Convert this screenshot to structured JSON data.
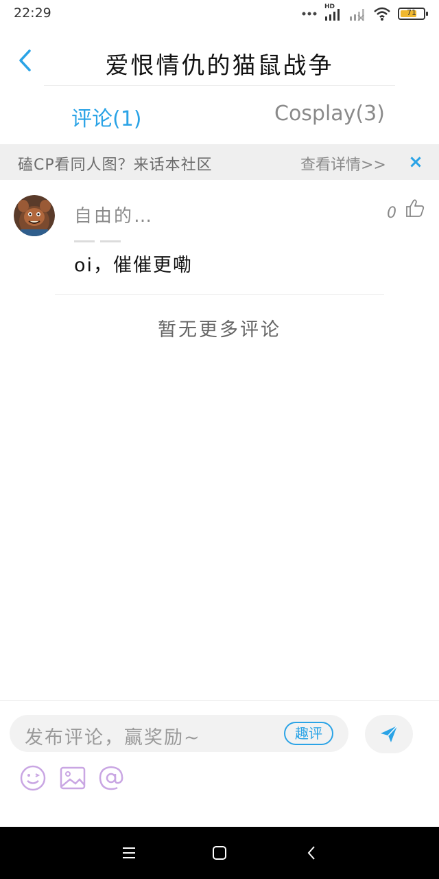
{
  "status_bar": {
    "time": "22:29",
    "network_label": "HD",
    "battery_level": "71"
  },
  "header": {
    "title": "爱恨情仇的猫鼠战争"
  },
  "tabs": [
    {
      "label": "评论(1)",
      "active": true
    },
    {
      "label": "Cosplay(3)",
      "active": false
    }
  ],
  "banner": {
    "text": "磕CP看同人图？来话本社区",
    "link": "查看详情>>",
    "close": "×"
  },
  "comments": [
    {
      "user": "自由的…",
      "likes": "0",
      "text": "oi，催催更嘞"
    }
  ],
  "no_more_text": "暂无更多评论",
  "composer": {
    "placeholder": "发布评论，赢奖励~",
    "badge": "趣评"
  },
  "colors": {
    "accent": "#2aa3e6",
    "tool_icon": "#c9a6e3",
    "banner_bg": "#efefef",
    "nav_bg": "#000000"
  },
  "icons": {
    "back": "chevron-left-icon",
    "like": "thumbs-up-icon",
    "send": "paper-plane-icon",
    "emoji": "smiley-icon",
    "image": "image-icon",
    "mention": "at-icon"
  }
}
